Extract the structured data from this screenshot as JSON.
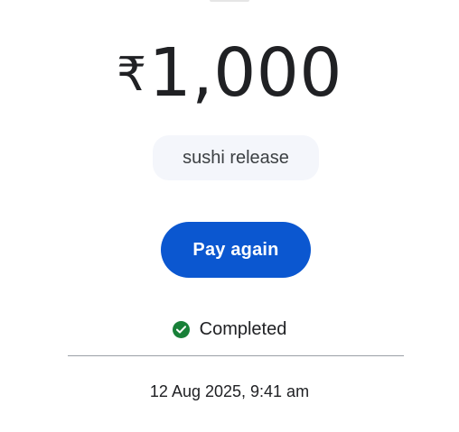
{
  "payment": {
    "currency_symbol": "₹",
    "amount": "1,000",
    "note": "sushi release",
    "status_icon": "check-circle-icon",
    "status": "Completed",
    "timestamp": "12 Aug 2025, 9:41 am"
  },
  "actions": {
    "pay_again_label": "Pay again"
  },
  "colors": {
    "primary_button": "#0b57d0",
    "success": "#188038",
    "chip_background": "#f4f6fb",
    "divider": "#9aa0a6"
  }
}
